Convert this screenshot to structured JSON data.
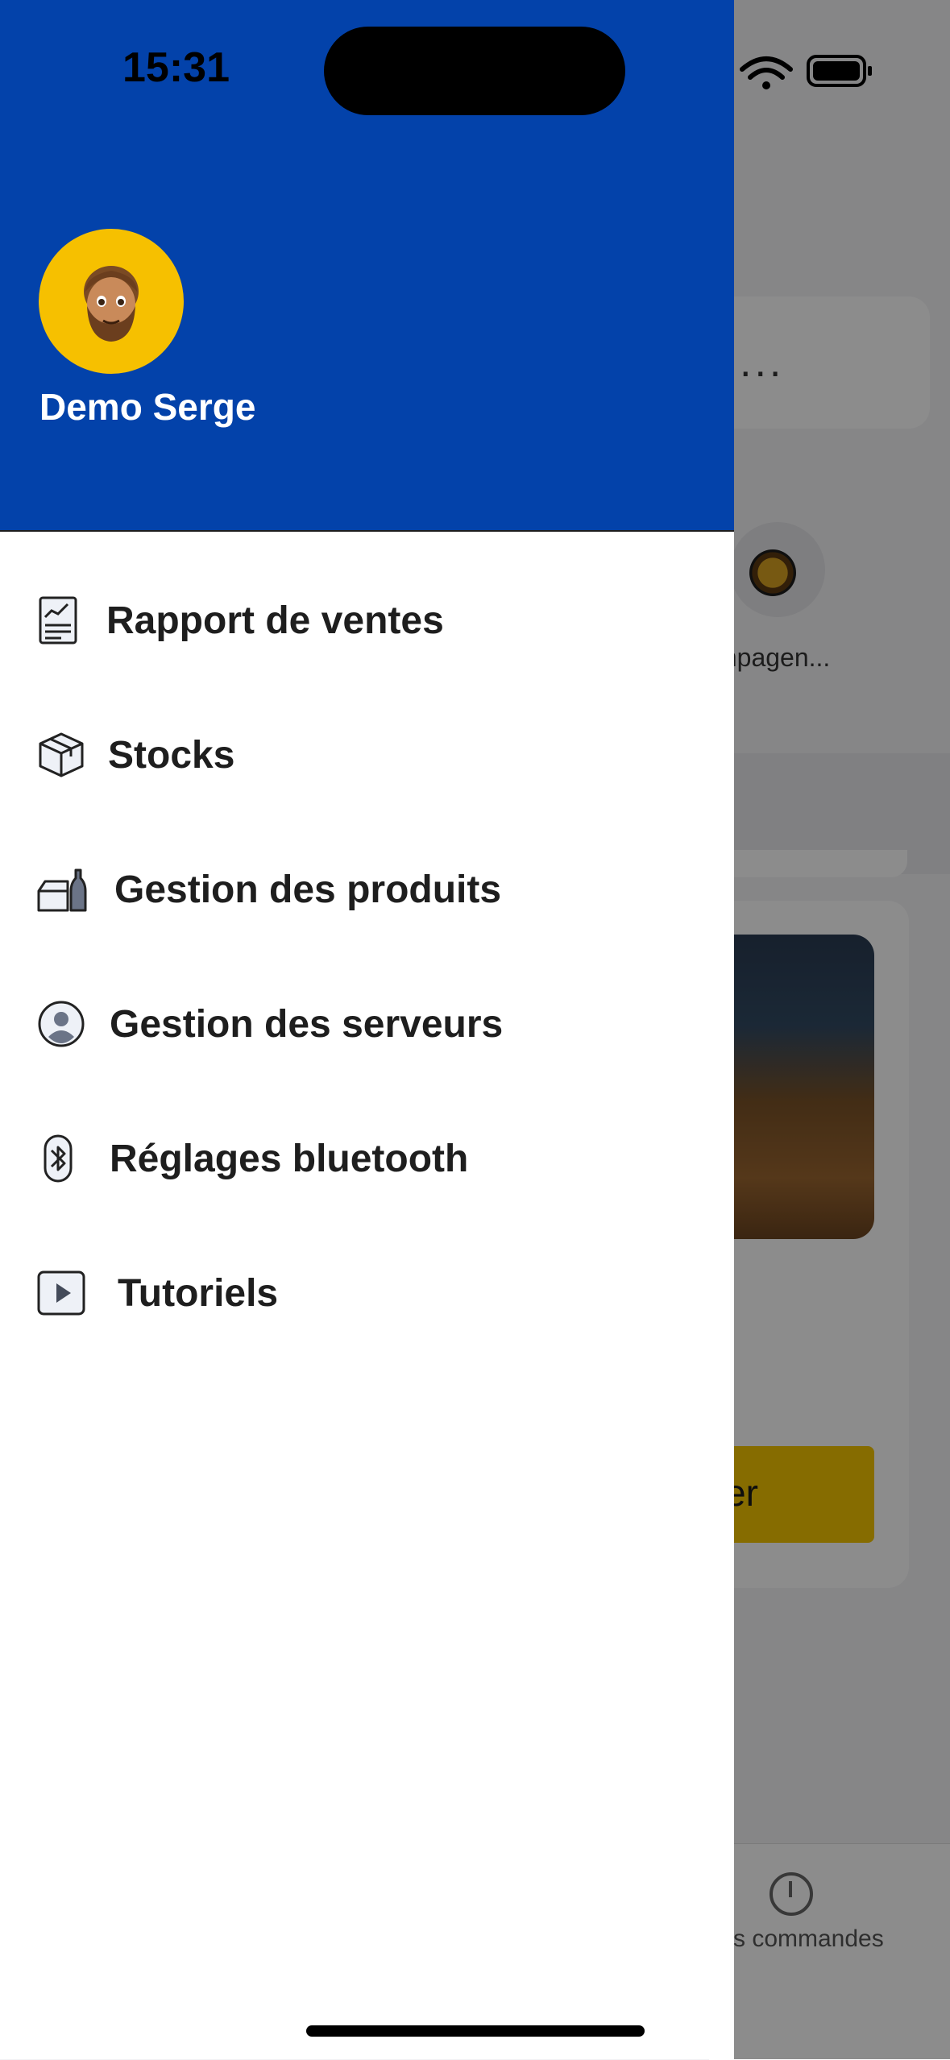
{
  "status_bar": {
    "time": "15:31"
  },
  "drawer": {
    "user_name": "Demo Serge",
    "colors": {
      "header": "#0342aa",
      "avatar": "#f6c000"
    },
    "menu": [
      {
        "label": "Rapport  de ventes",
        "icon": "sales-report-icon"
      },
      {
        "label": "Stocks",
        "icon": "box-icon"
      },
      {
        "label": "Gestion des produits",
        "icon": "products-icon"
      },
      {
        "label": "Gestion des serveurs",
        "icon": "user-circle-icon"
      },
      {
        "label": "Réglages bluetooth",
        "icon": "bluetooth-icon"
      },
      {
        "label": "Tutoriels",
        "icon": "play-icon"
      }
    ]
  },
  "background": {
    "search_placeholder": "...",
    "category_label": "mpagen...",
    "button_label": "er",
    "tab_label": "s commandes",
    "colors": {
      "button": "#f4c500"
    }
  }
}
